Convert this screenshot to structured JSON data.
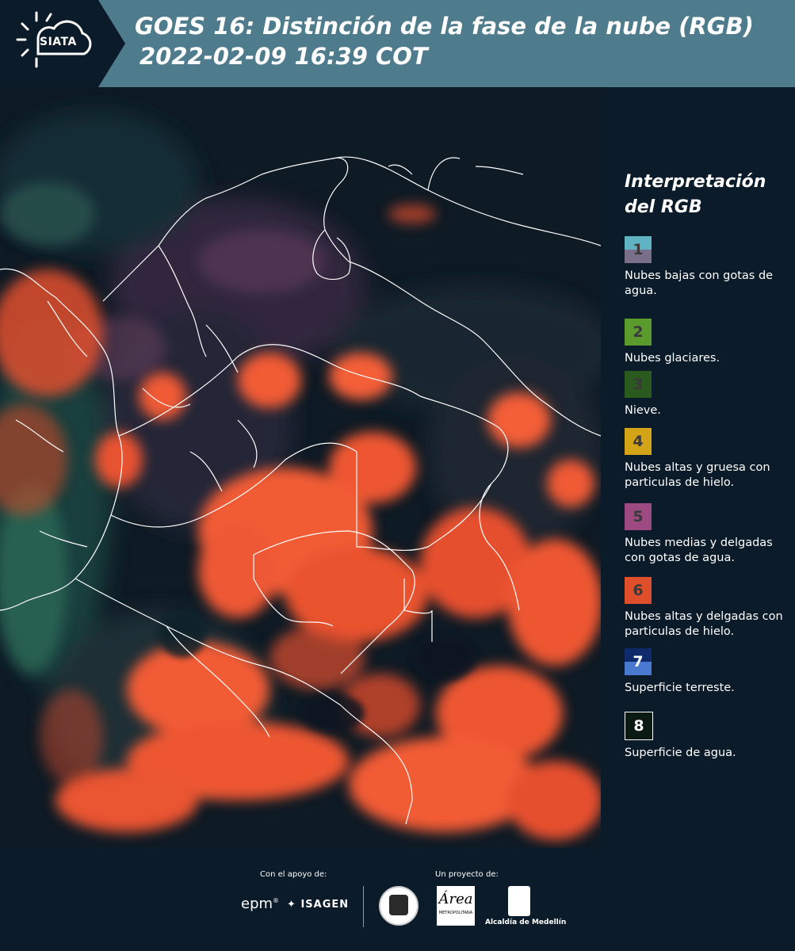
{
  "header": {
    "logo_text": "SIATA",
    "title_line1": "GOES 16: Distinción de la fase de la nube (RGB)",
    "title_line2": "2022-02-09 16:39 COT"
  },
  "legend": {
    "title_line1": "Interpretación",
    "title_line2": "del RGB",
    "items": [
      {
        "number": "1",
        "label": "Nubes bajas con gotas de agua.",
        "color_top": "#5fb3c3",
        "color_bottom": "#7a6f8b"
      },
      {
        "number": "2",
        "label": "Nubes glaciares.",
        "color_top": "#5b9b2e",
        "color_bottom": "#5b9b2e"
      },
      {
        "number": "3",
        "label": "Nieve.",
        "color_top": "#2b5a1e",
        "color_bottom": "#2b5a1e"
      },
      {
        "number": "4",
        "label": "Nubes altas y gruesa con particulas de hielo.",
        "color_top": "#d4a418",
        "color_bottom": "#d4a418"
      },
      {
        "number": "5",
        "label": "Nubes medias y delgadas con gotas de agua.",
        "color_top": "#9e4a82",
        "color_bottom": "#9e4a82"
      },
      {
        "number": "6",
        "label": "Nubes altas y delgadas con particulas de hielo.",
        "color_top": "#e04f2c",
        "color_bottom": "#e04f2c"
      },
      {
        "number": "7",
        "label": "Superficie terreste.",
        "color_top": "#0f2a6a",
        "color_bottom": "#4a7ad0"
      },
      {
        "number": "8",
        "label": "Superficie de agua.",
        "color_top": "#0b1b14",
        "color_bottom": "#0b1b14"
      }
    ]
  },
  "footer": {
    "support_label": "Con el apoyo de:",
    "project_label": "Un proyecto de:",
    "brand_epm": "epm",
    "brand_isagen": "ISAGEN",
    "brand_area": "Área",
    "brand_area_sub": "METROPOLITANA",
    "brand_medellin": "Alcaldía de Medellín"
  },
  "colors": {
    "header_bg": "#4f7c8c",
    "page_bg": "#0b1b29",
    "cloud_ice": "#ff5a33"
  }
}
